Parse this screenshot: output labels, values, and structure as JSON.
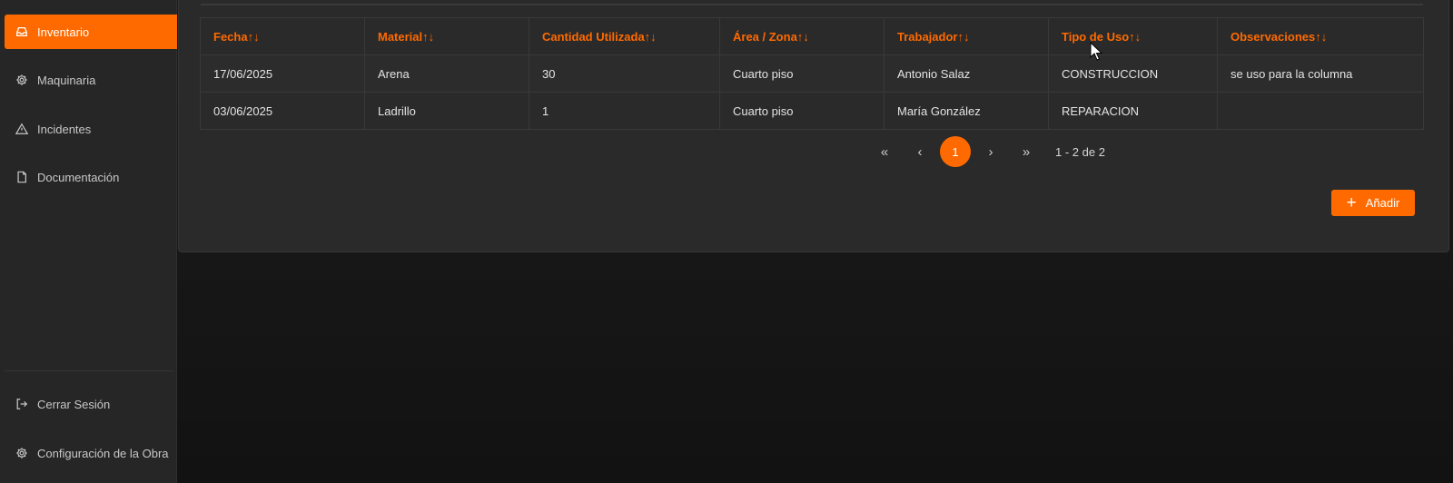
{
  "sidebar": {
    "items": [
      {
        "label": "Inventario",
        "icon": "inbox-icon",
        "active": true
      },
      {
        "label": "Maquinaria",
        "icon": "gear-icon"
      },
      {
        "label": "Incidentes",
        "icon": "warning-icon"
      },
      {
        "label": "Documentación",
        "icon": "file-icon"
      }
    ],
    "footer": [
      {
        "label": "Cerrar Sesión",
        "icon": "logout-icon"
      },
      {
        "label": "Configuración de la Obra",
        "icon": "gear-icon"
      }
    ]
  },
  "table": {
    "columns": [
      "Fecha↑↓",
      "Material↑↓",
      "Cantidad Utilizada↑↓",
      "Área / Zona↑↓",
      "Trabajador↑↓",
      "Tipo de Uso↑↓",
      "Observaciones↑↓"
    ],
    "rows": [
      [
        "17/06/2025",
        "Arena",
        "30",
        "Cuarto piso",
        "Antonio Salaz",
        "CONSTRUCCION",
        "se uso para la columna"
      ],
      [
        "03/06/2025",
        "Ladrillo",
        "1",
        "Cuarto piso",
        "María González",
        "REPARACION",
        ""
      ]
    ]
  },
  "pagination": {
    "first": "«",
    "prev": "‹",
    "current_page": "1",
    "next": "›",
    "last": "»",
    "info": "1 - 2 de 2"
  },
  "actions": {
    "add_icon": "+",
    "add_label": "Añadir"
  },
  "colors": {
    "accent": "#ff6a00",
    "background": "#1a1a1a",
    "panel": "#2a2a2a",
    "sidebar": "#262626"
  }
}
